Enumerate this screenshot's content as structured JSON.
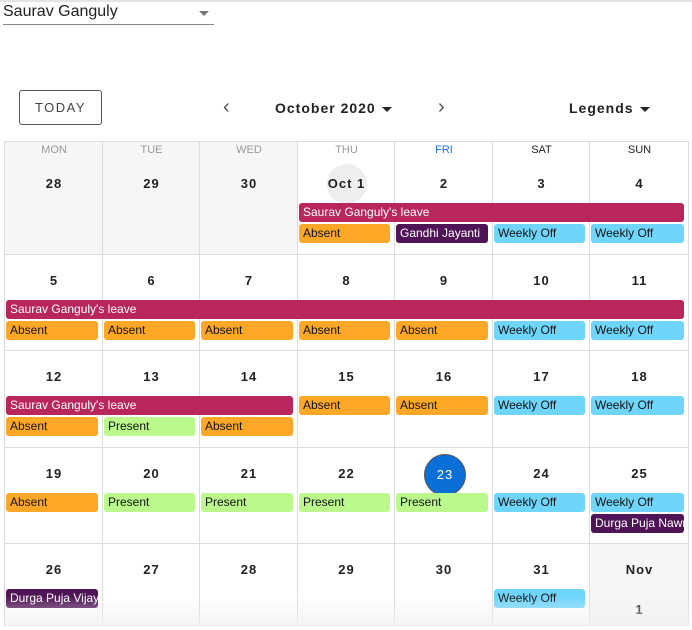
{
  "employee_select": {
    "value": "Saurav  Ganguly"
  },
  "toolbar": {
    "today_label": "TODAY",
    "prev_icon": "chevron-left",
    "next_icon": "chevron-right",
    "month_label": "October 2020",
    "legends_label": "Legends"
  },
  "weekdays": [
    "MON",
    "TUE",
    "WED",
    "THU",
    "FRI",
    "SAT",
    "SUN"
  ],
  "current_weekday": "FRI",
  "colors": {
    "leave": "#b8265c",
    "absent": "#ffa726",
    "present": "#bbf98c",
    "weekly_off": "#6fd5fb",
    "holiday": "#4f1455",
    "today": "#0a6fd6"
  },
  "weeks": [
    {
      "days": [
        "28",
        "29",
        "30",
        "Oct 1",
        "2",
        "3",
        "4"
      ],
      "events": [
        {
          "label": "Saurav Ganguly's leave",
          "type": "leave",
          "start": 3,
          "span": 4,
          "row": 0
        },
        {
          "label": "Absent",
          "type": "absent",
          "start": 3,
          "span": 1,
          "row": 1
        },
        {
          "label": "Gandhi Jayanti",
          "type": "holiday",
          "start": 4,
          "span": 1,
          "row": 1
        },
        {
          "label": "Weekly Off",
          "type": "weekly_off",
          "start": 5,
          "span": 1,
          "row": 1
        },
        {
          "label": "Weekly Off",
          "type": "weekly_off",
          "start": 6,
          "span": 1,
          "row": 1
        }
      ]
    },
    {
      "days": [
        "5",
        "6",
        "7",
        "8",
        "9",
        "10",
        "11"
      ],
      "events": [
        {
          "label": "Saurav Ganguly's leave",
          "type": "leave",
          "start": 0,
          "span": 7,
          "row": 0
        },
        {
          "label": "Absent",
          "type": "absent",
          "start": 0,
          "span": 1,
          "row": 1
        },
        {
          "label": "Absent",
          "type": "absent",
          "start": 1,
          "span": 1,
          "row": 1
        },
        {
          "label": "Absent",
          "type": "absent",
          "start": 2,
          "span": 1,
          "row": 1
        },
        {
          "label": "Absent",
          "type": "absent",
          "start": 3,
          "span": 1,
          "row": 1
        },
        {
          "label": "Absent",
          "type": "absent",
          "start": 4,
          "span": 1,
          "row": 1
        },
        {
          "label": "Weekly Off",
          "type": "weekly_off",
          "start": 5,
          "span": 1,
          "row": 1
        },
        {
          "label": "Weekly Off",
          "type": "weekly_off",
          "start": 6,
          "span": 1,
          "row": 1
        }
      ]
    },
    {
      "days": [
        "12",
        "13",
        "14",
        "15",
        "16",
        "17",
        "18"
      ],
      "events": [
        {
          "label": "Saurav Ganguly's leave",
          "type": "leave",
          "start": 0,
          "span": 3,
          "row": 0
        },
        {
          "label": "Absent",
          "type": "absent",
          "start": 0,
          "span": 1,
          "row": 1
        },
        {
          "label": "Present",
          "type": "present",
          "start": 1,
          "span": 1,
          "row": 1
        },
        {
          "label": "Absent",
          "type": "absent",
          "start": 2,
          "span": 1,
          "row": 1
        },
        {
          "label": "Absent",
          "type": "absent",
          "start": 3,
          "span": 1,
          "row": 0
        },
        {
          "label": "Absent",
          "type": "absent",
          "start": 4,
          "span": 1,
          "row": 0
        },
        {
          "label": "Weekly Off",
          "type": "weekly_off",
          "start": 5,
          "span": 1,
          "row": 0
        },
        {
          "label": "Weekly Off",
          "type": "weekly_off",
          "start": 6,
          "span": 1,
          "row": 0
        }
      ]
    },
    {
      "days": [
        "19",
        "20",
        "21",
        "22",
        "23",
        "24",
        "25"
      ],
      "events": [
        {
          "label": "Absent",
          "type": "absent",
          "start": 0,
          "span": 1,
          "row": 0
        },
        {
          "label": "Present",
          "type": "present",
          "start": 1,
          "span": 1,
          "row": 0
        },
        {
          "label": "Present",
          "type": "present",
          "start": 2,
          "span": 1,
          "row": 0
        },
        {
          "label": "Present",
          "type": "present",
          "start": 3,
          "span": 1,
          "row": 0
        },
        {
          "label": "Present",
          "type": "present",
          "start": 4,
          "span": 1,
          "row": 0
        },
        {
          "label": "Weekly Off",
          "type": "weekly_off",
          "start": 5,
          "span": 1,
          "row": 0
        },
        {
          "label": "Weekly Off",
          "type": "weekly_off",
          "start": 6,
          "span": 1,
          "row": 0
        },
        {
          "label": "Durga Puja Nawmi",
          "type": "holiday",
          "start": 6,
          "span": 1,
          "row": 1
        }
      ]
    },
    {
      "days": [
        "26",
        "27",
        "28",
        "29",
        "30",
        "31",
        "Nov 1"
      ],
      "events": [
        {
          "label": "Durga Puja Vijaya Dashami",
          "type": "holiday",
          "start": 0,
          "span": 1,
          "row": 0
        },
        {
          "label": "Weekly Off",
          "type": "weekly_off",
          "start": 5,
          "span": 1,
          "row": 0
        }
      ]
    }
  ],
  "today_date": "23",
  "selected_date": "Oct 1"
}
